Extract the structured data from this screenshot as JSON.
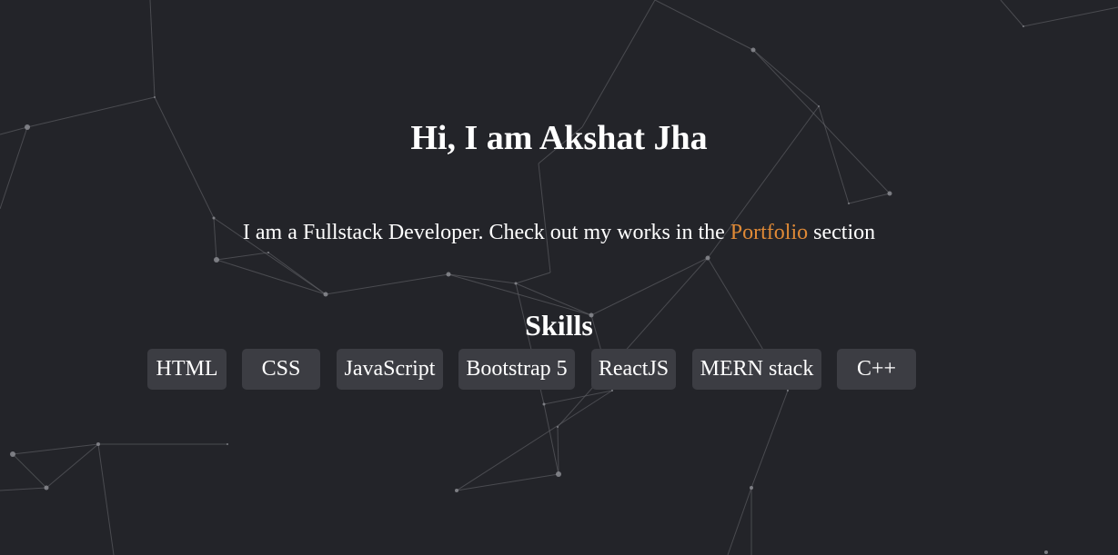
{
  "hero": {
    "title": "Hi, I am Akshat Jha",
    "subtitle_before": "I am a Fullstack Developer. Check out my works in the ",
    "subtitle_link": "Portfolio",
    "subtitle_after": " section"
  },
  "skills": {
    "heading": "Skills",
    "items": [
      "HTML",
      "CSS",
      "JavaScript",
      "Bootstrap 5",
      "ReactJS",
      "MERN stack",
      "C++"
    ]
  },
  "colors": {
    "background": "#232429",
    "link_accent": "#e08a36",
    "chip_background": "#3c3d43",
    "text": "#ffffff"
  }
}
